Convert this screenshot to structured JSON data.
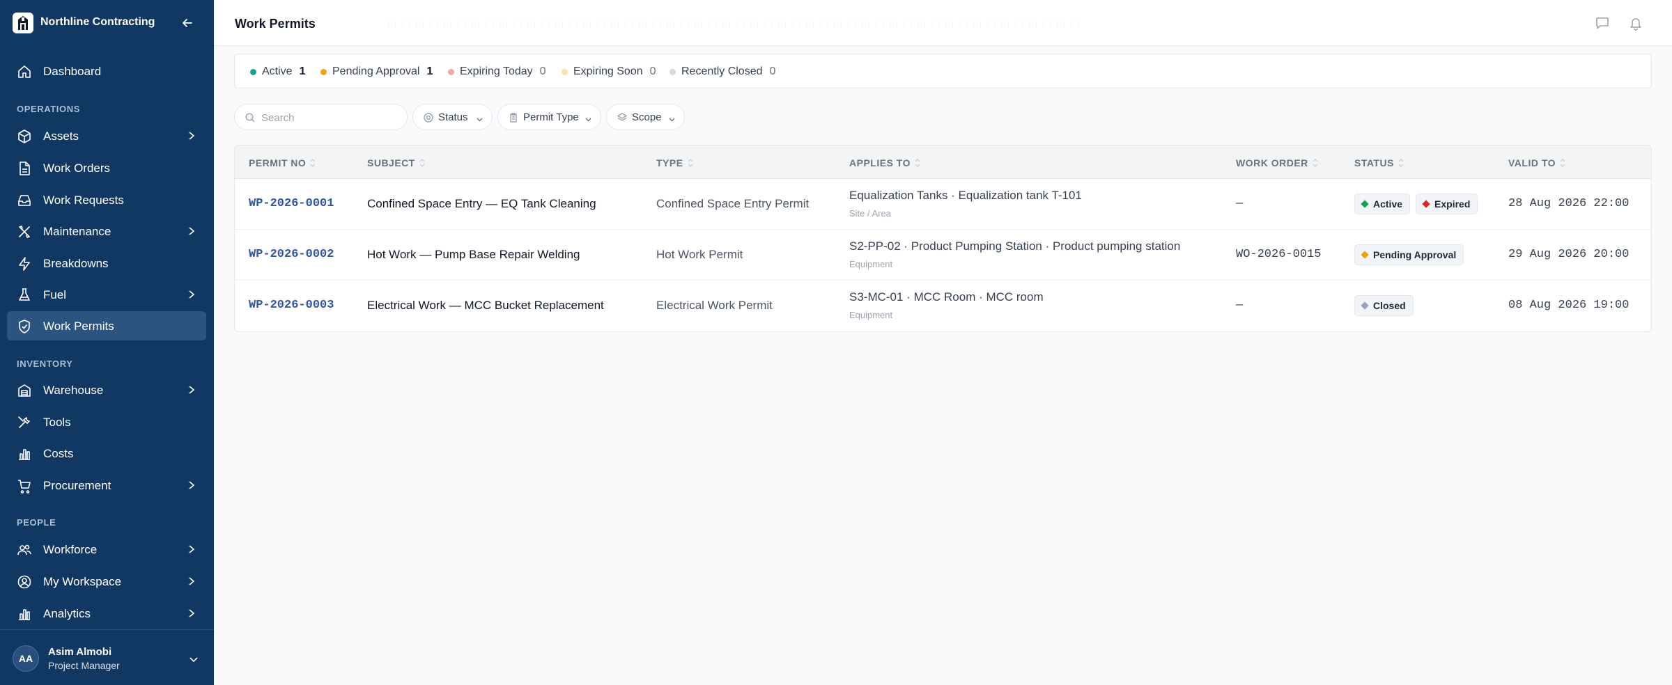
{
  "app": {
    "name": "Northline Contracting"
  },
  "sidebar": {
    "items": [
      {
        "label": "Dashboard",
        "icon": "home-icon"
      },
      {
        "section": "OPERATIONS"
      },
      {
        "label": "Assets",
        "icon": "box-icon",
        "has_children": true
      },
      {
        "label": "Work Orders",
        "icon": "document-icon"
      },
      {
        "label": "Work Requests",
        "icon": "inbox-icon"
      },
      {
        "label": "Maintenance",
        "icon": "wrench-icon",
        "has_children": true
      },
      {
        "label": "Breakdowns",
        "icon": "lightning-icon"
      },
      {
        "label": "Fuel",
        "icon": "flask-icon",
        "has_children": true
      },
      {
        "label": "Work Permits",
        "icon": "shield-check-icon",
        "active": true
      },
      {
        "section": "INVENTORY"
      },
      {
        "label": "Warehouse",
        "icon": "warehouse-icon",
        "has_children": true
      },
      {
        "label": "Tools",
        "icon": "tools-icon"
      },
      {
        "label": "Costs",
        "icon": "bar-chart-icon"
      },
      {
        "label": "Procurement",
        "icon": "cart-icon",
        "has_children": true
      },
      {
        "section": "PEOPLE"
      },
      {
        "label": "Workforce",
        "icon": "users-icon",
        "has_children": true
      },
      {
        "label": "My Workspace",
        "icon": "user-circle-icon",
        "has_children": true
      },
      {
        "label": "Analytics",
        "icon": "bar-chart-icon",
        "has_children": true
      }
    ],
    "labels": {
      "dashboard": "Dashboard",
      "operations": "OPERATIONS",
      "assets": "Assets",
      "work_orders": "Work Orders",
      "work_requests": "Work Requests",
      "maintenance": "Maintenance",
      "breakdowns": "Breakdowns",
      "fuel": "Fuel",
      "work_permits": "Work Permits",
      "inventory": "INVENTORY",
      "warehouse": "Warehouse",
      "tools": "Tools",
      "costs": "Costs",
      "procurement": "Procurement",
      "people": "PEOPLE",
      "workforce": "Workforce",
      "my_workspace": "My Workspace",
      "analytics": "Analytics"
    }
  },
  "user": {
    "initials": "AA",
    "name": "Asim Almobi",
    "role": "Project Manager"
  },
  "header": {
    "title": "Work Permits"
  },
  "summary": {
    "active": {
      "label": "Active",
      "count": "1",
      "color": "#16a394"
    },
    "pending": {
      "label": "Pending Approval",
      "count": "1",
      "color": "#f0a21a"
    },
    "expiring_today": {
      "label": "Expiring Today",
      "count": "0",
      "color": "#f0a8a8"
    },
    "expiring_soon": {
      "label": "Expiring Soon",
      "count": "0",
      "color": "#fde2a8"
    },
    "recently_closed": {
      "label": "Recently Closed",
      "count": "0",
      "color": "#d6d9de"
    }
  },
  "filters": {
    "search_placeholder": "Search",
    "search_value": "",
    "status": "Status",
    "permit_type": "Permit Type",
    "scope": "Scope"
  },
  "table": {
    "columns": {
      "permit_no": "PERMIT NO",
      "subject": "SUBJECT",
      "type": "TYPE",
      "applies_to": "APPLIES TO",
      "work_order": "WORK ORDER",
      "status": "STATUS",
      "valid_to": "VALID TO"
    },
    "rows": [
      {
        "permit_no": "WP-2026-0001",
        "subject": "Confined Space Entry — EQ Tank Cleaning",
        "type": "Confined Space Entry Permit",
        "applies_to": "Equalization Tanks · Equalization tank T-101",
        "applies_sub": "Site / Area",
        "work_order": "—",
        "status": [
          {
            "label": "Active",
            "color": "#16a34a"
          },
          {
            "label": "Expired",
            "color": "#dc2626"
          }
        ],
        "valid_to": "28 Aug 2026 22:00"
      },
      {
        "permit_no": "WP-2026-0002",
        "subject": "Hot Work — Pump Base Repair Welding",
        "type": "Hot Work Permit",
        "applies_to": "S2-PP-02 · Product Pumping Station · Product pumping station",
        "applies_sub": "Equipment",
        "work_order": "WO-2026-0015",
        "status": [
          {
            "label": "Pending Approval",
            "color": "#f59e0b"
          }
        ],
        "valid_to": "29 Aug 2026 20:00"
      },
      {
        "permit_no": "WP-2026-0003",
        "subject": "Electrical Work — MCC Bucket Replacement",
        "type": "Electrical Work Permit",
        "applies_to": "S3-MC-01 · MCC Room · MCC room",
        "applies_sub": "Equipment",
        "work_order": "—",
        "status": [
          {
            "label": "Closed",
            "color": "#94a3b8"
          }
        ],
        "valid_to": "08 Aug 2026 19:00"
      }
    ]
  },
  "colors": {
    "sidebar_bg": "#113763",
    "sidebar_active": "#2d5381",
    "link": "#2f55a4"
  }
}
